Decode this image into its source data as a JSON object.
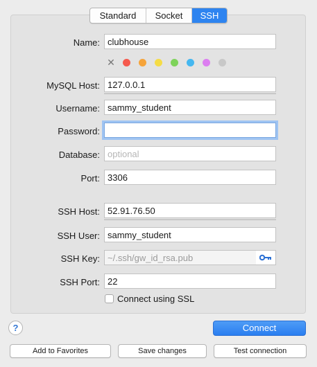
{
  "tabs": [
    {
      "label": "Standard"
    },
    {
      "label": "Socket"
    },
    {
      "label": "SSH"
    }
  ],
  "form": {
    "name": {
      "label": "Name:",
      "value": "clubhouse"
    },
    "colors": [
      "#f55a4e",
      "#f6a43a",
      "#f5dc46",
      "#7ed35a",
      "#45b7f0",
      "#dc7ef0",
      "#c8c8c8"
    ],
    "mysql_host": {
      "label": "MySQL Host:",
      "value": "127.0.0.1"
    },
    "username": {
      "label": "Username:",
      "value": "sammy_student"
    },
    "password": {
      "label": "Password:",
      "value": ""
    },
    "database": {
      "label": "Database:",
      "placeholder": "optional"
    },
    "port": {
      "label": "Port:",
      "value": "3306"
    },
    "ssh_host": {
      "label": "SSH Host:",
      "value": "52.91.76.50"
    },
    "ssh_user": {
      "label": "SSH User:",
      "value": "sammy_student"
    },
    "ssh_key": {
      "label": "SSH Key:",
      "value": "~/.ssh/gw_id_rsa.pub"
    },
    "ssh_port": {
      "label": "SSH Port:",
      "value": "22"
    },
    "ssl": {
      "label": "Connect using SSL",
      "checked": false
    }
  },
  "actions": {
    "help": "?",
    "connect": "Connect",
    "add_favorites": "Add to Favorites",
    "save_changes": "Save changes",
    "test_connection": "Test connection"
  }
}
